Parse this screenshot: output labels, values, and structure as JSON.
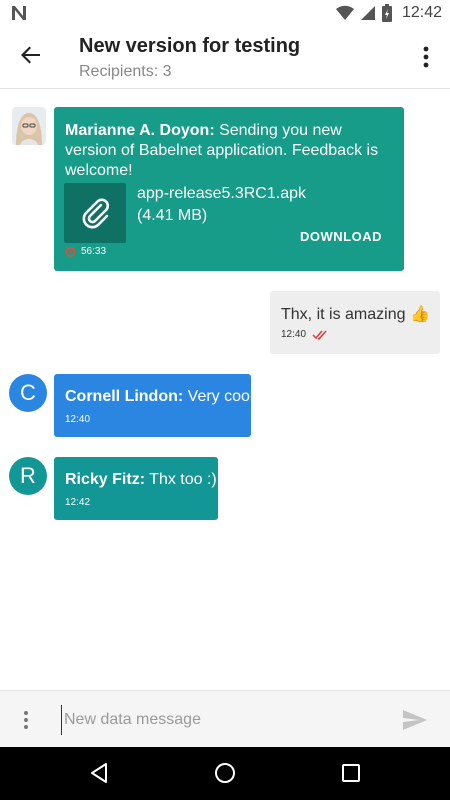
{
  "status_bar": {
    "time": "12:42"
  },
  "header": {
    "title": "New version for testing",
    "subtitle": "Recipients: 3"
  },
  "messages": [
    {
      "sender": "Marianne A. Doyon:",
      "text": " Sending you new version of Babelnet application. Feedback is welcome!",
      "attachment": {
        "name": "app-release5.3RC1.apk",
        "size": "(4.41 MB)",
        "action": "DOWNLOAD"
      },
      "timer": "56:33",
      "color": "#179c89"
    },
    {
      "text": "Thx, it is amazing",
      "emoji": "👍",
      "time": "12:40",
      "color": "#eeeeee"
    },
    {
      "avatar_letter": "C",
      "sender": "Cornell Lindon:",
      "text": " Very cool",
      "time": "12:40",
      "color": "#2a86e1"
    },
    {
      "avatar_letter": "R",
      "sender": "Ricky Fitz:",
      "text": " Thx too :)",
      "time": "12:42",
      "color": "#139696"
    }
  ],
  "composer": {
    "placeholder": "New data message"
  },
  "icons": {
    "back": "arrow-back-icon",
    "menu": "more-vert-icon",
    "attachment": "paperclip-icon",
    "timer": "timer-icon",
    "read": "double-check-icon",
    "send": "send-icon",
    "nav_back": "nav-back-icon",
    "nav_home": "nav-home-icon",
    "nav_recents": "nav-recents-icon"
  }
}
